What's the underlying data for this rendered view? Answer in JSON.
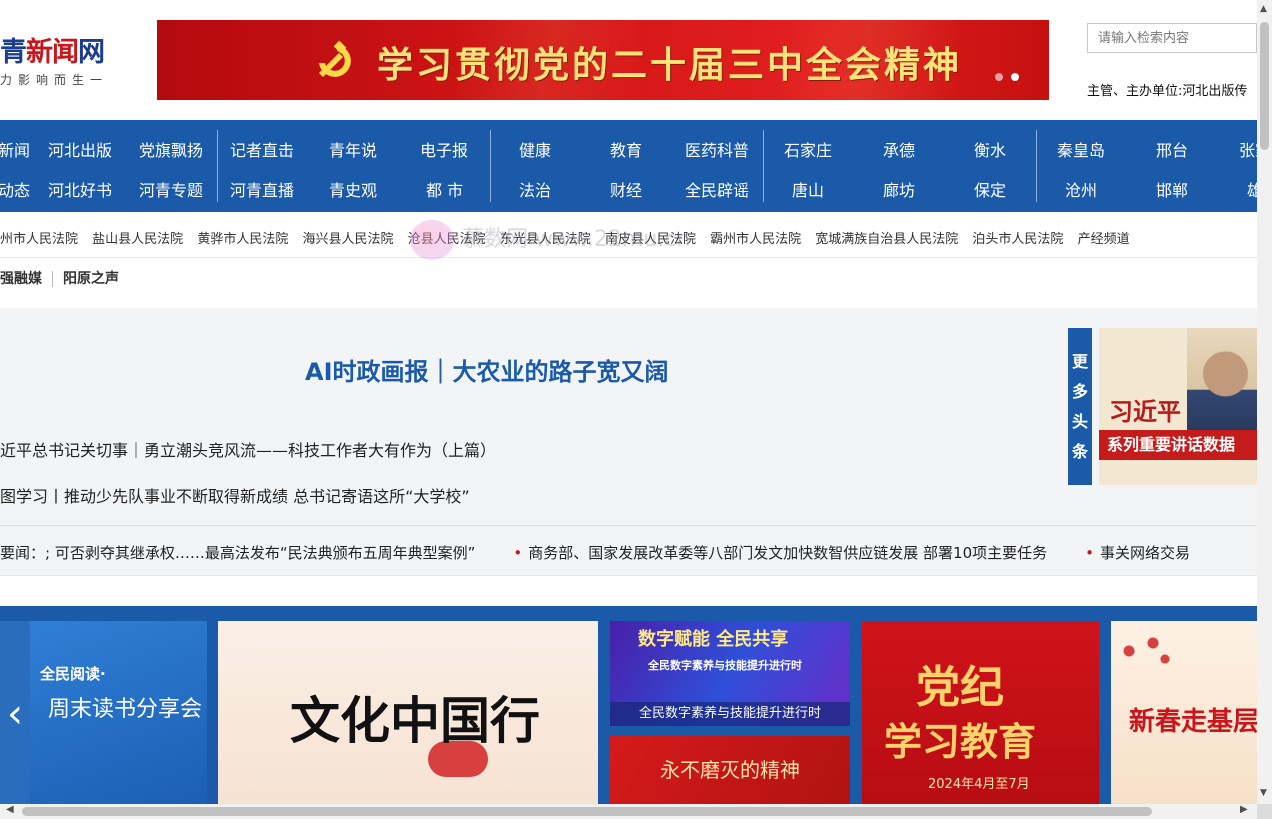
{
  "header": {
    "logo_main_blue1": "青",
    "logo_main_red": "新闻",
    "logo_main_blue2": "网",
    "logo_sub": "力影响而生一",
    "banner_title": "学习贯彻党的二十届三中全会精神",
    "search_placeholder": "请输入检索内容",
    "sponsor": "主管、主办单位:河北出版传"
  },
  "nav": {
    "row1": [
      "新闻",
      "河北出版",
      "党旗飘扬",
      "记者直击",
      "青年说",
      "电子报",
      "健康",
      "教育",
      "医药科普",
      "石家庄",
      "承德",
      "衡水",
      "秦皇岛",
      "邢台",
      "张家"
    ],
    "row2": [
      "动态",
      "河北好书",
      "河青专题",
      "河青直播",
      "青史观",
      "都 市",
      "法治",
      "财经",
      "全民辟谣",
      "唐山",
      "廊坊",
      "保定",
      "沧州",
      "邯郸",
      "雄安"
    ]
  },
  "courts": [
    "州市人民法院",
    "盐山县人民法院",
    "黄骅市人民法院",
    "海兴县人民法院",
    "沧县人民法院",
    "东光县人民法院",
    "南皮县人民法院",
    "霸州市人民法院",
    "宽城满族自治县人民法院",
    "泊头市人民法院",
    "产经频道"
  ],
  "sub_links": [
    "强融媒",
    "阳原之声"
  ],
  "headline": {
    "title": "AI时政画报｜大农业的路子宽又阔",
    "story1": "近平总书记关切事｜勇立潮头竞风流——科技工作者大有作为（上篇）",
    "story2": "图学习丨推动少先队事业不断取得新成绩 总书记寄语这所“大学校”",
    "more_label": [
      "更",
      "多",
      "头",
      "条"
    ],
    "xi_name": "习近平",
    "xi_bar": "系列重要讲话数据"
  },
  "ticker": {
    "label": "要闻：",
    "item1": "; 可否剥夺其继承权……最高法发布“民法典颁布五周年典型案例”",
    "item2": "商务部、国家发展改革委等八部门发文加快数智供应链发展 部署10项主要任务",
    "item3": "事关网络交易"
  },
  "carousel": {
    "tile1_a": "全民阅读·",
    "tile1_b": "周末读书分享会",
    "tile2": "文化中国行",
    "tile3_a": "数字赋能 全民共享",
    "tile3_b": "全民数字素养与技能提升进行时",
    "tile3_c": "全民数字素养与技能提升进行时",
    "tile4": "永不磨灭的精神",
    "tile5_a": "党纪",
    "tile5_b": "学习教育",
    "tile5_c": "2024年4月至7月",
    "tile6": "新春走基层"
  },
  "watermark": "慕数网 www.22mu.cn"
}
